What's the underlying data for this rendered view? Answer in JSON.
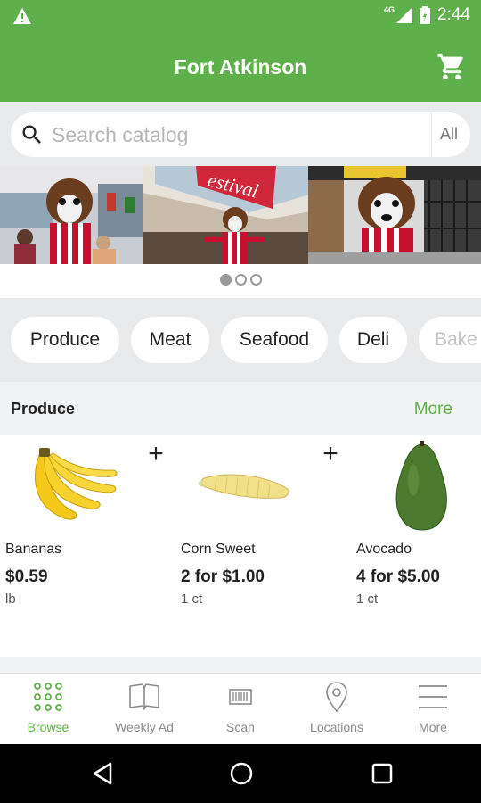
{
  "status_bar": {
    "network": "4G",
    "time": "2:44"
  },
  "app_bar": {
    "title": "Fort Atkinson",
    "cart_icon": "shopping-cart-icon"
  },
  "search": {
    "placeholder": "Search catalog",
    "value": "",
    "scope": "All"
  },
  "carousel": {
    "slide_count": 3,
    "active_index": 0,
    "sign_text": "estival"
  },
  "categories": [
    "Produce",
    "Meat",
    "Seafood",
    "Deli",
    "Bake"
  ],
  "section": {
    "title": "Produce",
    "more_label": "More"
  },
  "products": [
    {
      "name": "Bananas",
      "price": "$0.59",
      "unit": "lb"
    },
    {
      "name": "Corn Sweet",
      "price": "2 for $1.00",
      "unit": "1 ct"
    },
    {
      "name": "Avocado",
      "price": "4 for $5.00",
      "unit": "1 ct"
    }
  ],
  "add_label": "+",
  "bottom_nav": [
    {
      "label": "Browse",
      "icon": "grid-icon",
      "active": true
    },
    {
      "label": "Weekly Ad",
      "icon": "book-icon",
      "active": false
    },
    {
      "label": "Scan",
      "icon": "barcode-icon",
      "active": false
    },
    {
      "label": "Locations",
      "icon": "location-pin-icon",
      "active": false
    },
    {
      "label": "More",
      "icon": "menu-icon",
      "active": false
    }
  ],
  "colors": {
    "brand_green": "#5eb14a",
    "background_gray": "#e9eaec",
    "section_gray": "#f1f2f3"
  }
}
